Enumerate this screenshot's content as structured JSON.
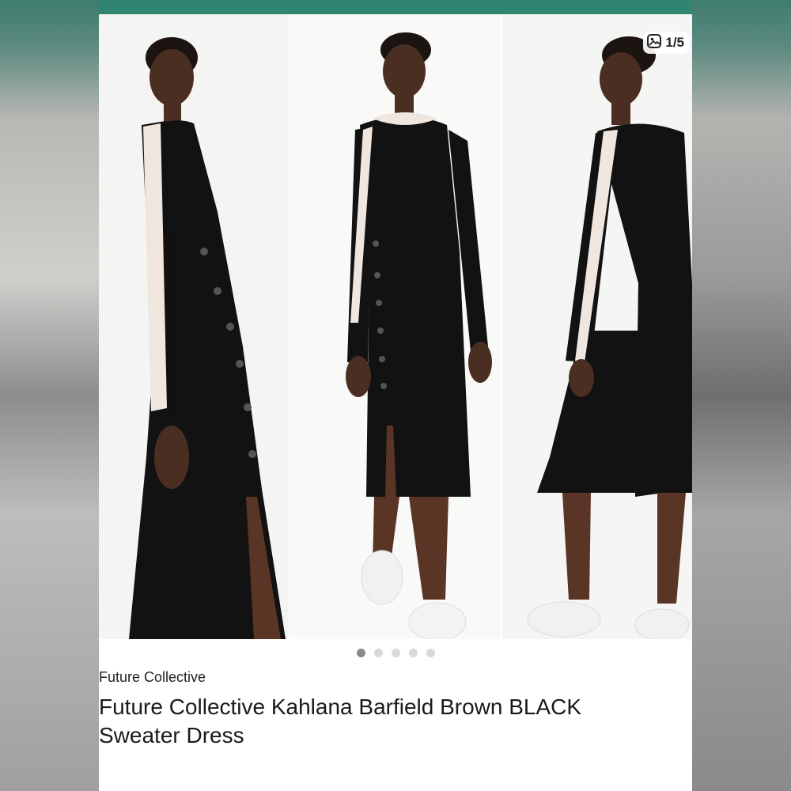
{
  "gallery": {
    "counter": "1/5",
    "total_images": 5,
    "active_index": 0,
    "icon": "image-icon"
  },
  "product": {
    "brand": "Future Collective",
    "title": "Future Collective Kahlana Barfield Brown BLACK Sweater Dress"
  },
  "colors": {
    "header": "#2f8571",
    "dress": "#111111",
    "stripe": "#efe6df"
  }
}
